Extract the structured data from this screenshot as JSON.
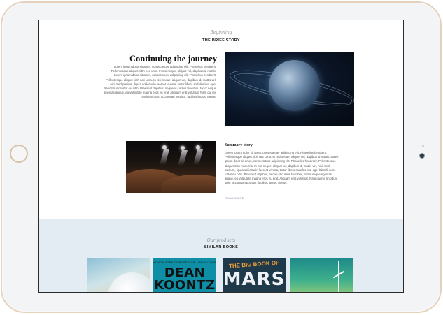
{
  "intro": {
    "eyebrow": "Beginning",
    "title": "THE BRIEF STORY"
  },
  "journey": {
    "heading": "Continuing the journey",
    "paragraph": "Lorem ipsum dolor sit amet, consectetuer adipiscing elit. Phasellus hendrerit. Pellentesque aliquet nibh nec urna. In nisi neque, aliquet vel, dapibus id mattis. Lorem ipsum dolor sit amet, consectetuer adipiscing elit. Phasellus hendrerit. Pellentesque aliquet nibh nec urna. In nisi neque, aliquet vel, dapibus id, mattis vel, nisi. Sed pretium, ligula sollicitudin laoreet viverra, tortor libero sodales leo, eget blandit nunc tortor eu nibh. Praesent dapibus, neque id cursus faucibus, tortor neque egestas augue, eu vulputate magna eros eu erat. Aliquam erat volutpat. Nam dui mi, tincidunt quis, accumsan porttitor, facilisis luctus, metus."
  },
  "summary": {
    "heading": "Summary story",
    "paragraph": "Lorem ipsum dolor sit amet, consectetuer adipiscing elit. Phasellus hendrerit. Pellentesque aliquet nibh nec urna. In nisi neque, aliquet vel, dapibus id mattis. Lorem ipsum dolor sit amet, consectetuer adipiscing elit. Phasellus hendrerit. Pellentesque aliquet nibh nec urna. In nisi neque, aliquet vel, dapibus id, mattis vel, nisi. Sed pretium, ligula sollicitudin laoreet viverra, tortor libero sodales leo, eget blandit nunc tortor eu nibh. Praesent dapibus, neque id cursus faucibus, tortor neque egestas augue, eu vulputate magna eros eu erat. Aliquam erat volutpat. Nam dui mi, tincidunt quis, accumsan porttitor, facilisis luctus, metus.",
    "read_more": "READ MORE"
  },
  "products": {
    "eyebrow": "Our products",
    "title": "SIMILAR BOOKS",
    "books": [
      {
        "cover_text": ""
      },
      {
        "top_line": "#1 NEW YORK TIMES BESTSELLING AUTHOR",
        "author_first": "DEAN",
        "author_last": "KOONTZ"
      },
      {
        "top_line": "THE BIG BOOK OF",
        "title_big": "MARS"
      },
      {
        "cover_text": ""
      }
    ]
  },
  "colors": {
    "frame": "#f2f4f6",
    "frame_border": "#e4d2bd",
    "products_bg": "#e3ecf2",
    "read_more": "#8a7a9a"
  },
  "icons": {
    "home_button": "home-button",
    "camera": "front-camera-icon"
  }
}
